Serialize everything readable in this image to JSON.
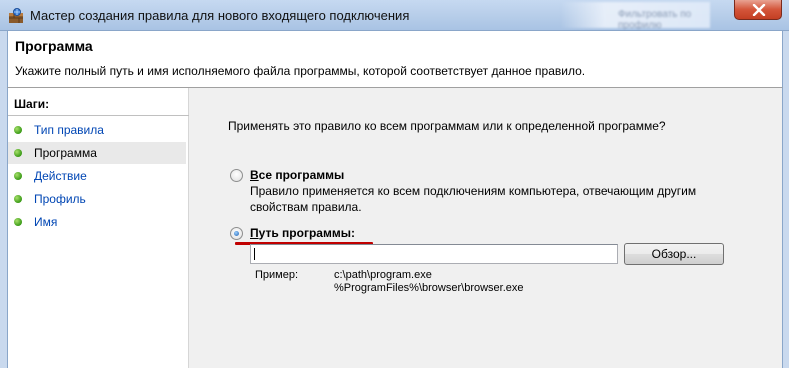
{
  "window": {
    "title": "Мастер создания правила для нового входящего подключения"
  },
  "titlebar_blur_text": "Фильтровать по профилю",
  "header": {
    "title": "Программа",
    "description": "Укажите полный путь и имя исполняемого файла программы, которой соответствует данное правило."
  },
  "steps": {
    "heading": "Шаги:",
    "items": [
      {
        "label": "Тип правила",
        "current": false
      },
      {
        "label": "Программа",
        "current": true
      },
      {
        "label": "Действие",
        "current": false
      },
      {
        "label": "Профиль",
        "current": false
      },
      {
        "label": "Имя",
        "current": false
      }
    ]
  },
  "main": {
    "question": "Применять это правило ко всем программам или к определенной программе?",
    "all_programs": {
      "label_hotkey": "В",
      "label_rest": "се программы",
      "description_line1": "Правило применяется ко всем подключениям компьютера, отвечающим другим",
      "description_line2": "свойствам правила.",
      "selected": false
    },
    "program_path": {
      "label_hotkey": "П",
      "label_rest": "уть программы:",
      "selected": true,
      "value": ""
    },
    "browse_button": "Обзор...",
    "example_label": "Пример:",
    "example_line1": "c:\\path\\program.exe",
    "example_line2": "%ProgramFiles%\\browser\\browser.exe"
  },
  "colors": {
    "accent_red": "#c00000",
    "link_blue": "#0046b4",
    "step_dot": "#3a9a17"
  }
}
